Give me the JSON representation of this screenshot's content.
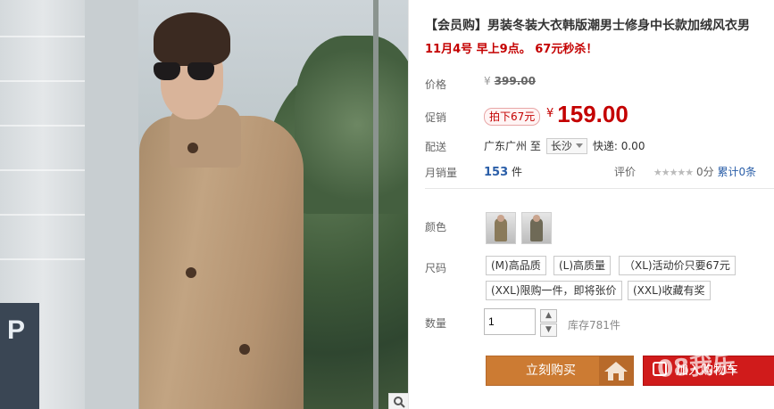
{
  "product": {
    "title": "【会员购】男装冬装大衣韩版潮男士修身中长款加绒风衣男",
    "promo": "11月4号 早上9点。 67元秒杀！"
  },
  "price": {
    "label": "价格",
    "currency": "¥",
    "original": "399.00"
  },
  "sale": {
    "label": "促销",
    "tag": "拍下67元",
    "currency": "¥",
    "value": "159.00"
  },
  "shipping": {
    "label": "配送",
    "from": "广东广州",
    "to_word": "至",
    "city": "长沙",
    "express": "快递: 0.00"
  },
  "monthly": {
    "label": "月销量",
    "count": "153",
    "unit": "件",
    "rating_label": "评价",
    "stars": "★★★★★",
    "score": "0分",
    "total": "累计0条"
  },
  "color": {
    "label": "颜色"
  },
  "size": {
    "label": "尺码",
    "options": [
      "(M)高品质",
      "(L)高质量",
      "（XL)活动价只要67元",
      "(XXL)限购一件，即将张价",
      "(XXL)收藏有奖"
    ]
  },
  "quantity": {
    "label": "数量",
    "value": "1",
    "stock": "库存781件"
  },
  "actions": {
    "buy": "立刻购买",
    "cart": "加入购物车",
    "watermark": "08我乐"
  },
  "icons": {
    "zoom": "magnifier-icon",
    "house": "house-icon",
    "cart": "cart-icon"
  },
  "colors": {
    "accent_red": "#c40000",
    "buy_orange": "#cc7b33",
    "cart_red": "#d01b1b",
    "link_blue": "#2a5ea8"
  }
}
